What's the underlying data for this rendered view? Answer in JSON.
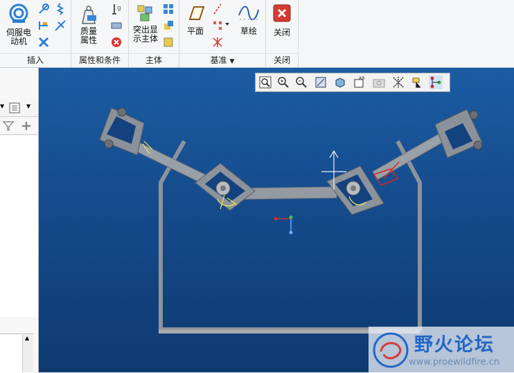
{
  "ribbon": {
    "groups": [
      {
        "label": "插入"
      },
      {
        "label": "属性和条件"
      },
      {
        "label": "主体"
      },
      {
        "label": "基准"
      },
      {
        "label": "关闭"
      }
    ],
    "servo_motor": "伺服电\n动机",
    "mass_props": "质量\n属性",
    "protrude_body": "突出显\n示主体",
    "plane": "平面",
    "sketch": "草绘",
    "close": "关闭"
  },
  "watermark": {
    "title": "野火论坛",
    "url": "www.proewildfire.cn"
  },
  "colors": {
    "viewport_top": "#1b5ca3",
    "viewport_bottom": "#0e3a70",
    "model_gray": "#8d939b"
  }
}
